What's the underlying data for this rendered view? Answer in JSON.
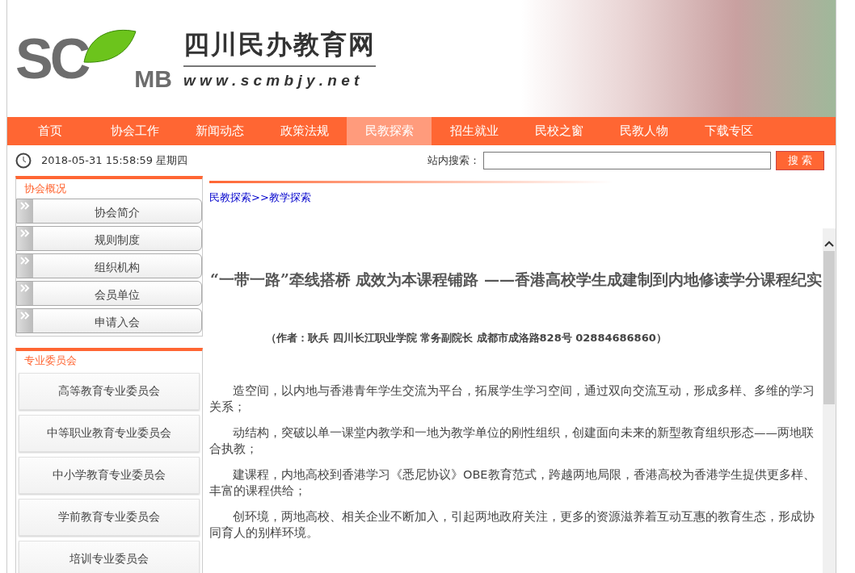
{
  "logo": {
    "letters": "SC",
    "small_letters": "MB",
    "site_name": "四川民办教育网",
    "url": "w w w . s c m b j y . n e t"
  },
  "nav": [
    {
      "label": "首页",
      "selected": false
    },
    {
      "label": "协会工作",
      "selected": false
    },
    {
      "label": "新闻动态",
      "selected": false
    },
    {
      "label": "政策法规",
      "selected": false
    },
    {
      "label": "民教探索",
      "selected": true
    },
    {
      "label": "招生就业",
      "selected": false
    },
    {
      "label": "民校之窗",
      "selected": false
    },
    {
      "label": "民教人物",
      "selected": false
    },
    {
      "label": "下载专区",
      "selected": false
    }
  ],
  "datetime": "2018-05-31 15:58:59 星期四",
  "search": {
    "label": "站内搜索：",
    "button": "搜 索"
  },
  "sidebar": [
    {
      "kind": "arrow",
      "title": "协会概况",
      "items": [
        "协会简介",
        "规则制度",
        "组织机构",
        "会员单位",
        "申请入会"
      ]
    },
    {
      "kind": "plain",
      "title": "专业委员会",
      "items": [
        "高等教育专业委员会",
        "中等职业教育专业委员会",
        "中小学教育专业委员会",
        "学前教育专业委员会",
        "培训专业委员会"
      ]
    }
  ],
  "breadcrumb": "民教探索>>教学探索",
  "article": {
    "title": "“一带一路”牵线搭桥 成效为本课程铺路 ——香港高校学生成建制到内地修读学分课程纪实",
    "byline": "（作者：耿兵  四川长江职业学院  常务副院长  成都市成洛路828号 02884686860）",
    "paragraphs": [
      "造空间，以内地与香港青年学生交流为平台，拓展学生学习空间，通过双向交流互动，形成多样、多维的学习关系；",
      "动结构，突破以单一课堂内教学和一地为教学单位的刚性组织，创建面向未来的新型教育组织形态——两地联合执教；",
      "建课程，内地高校到香港学习《悉尼协议》OBE教育范式，跨越两地局限，香港高校为香港学生提供更多样、丰富的课程供给；",
      "创环境，两地高校、相关企业不断加入，引起两地政府关注，更多的资源滋养着互动互惠的教育生态，形成协同育人的别样环境。"
    ]
  }
}
